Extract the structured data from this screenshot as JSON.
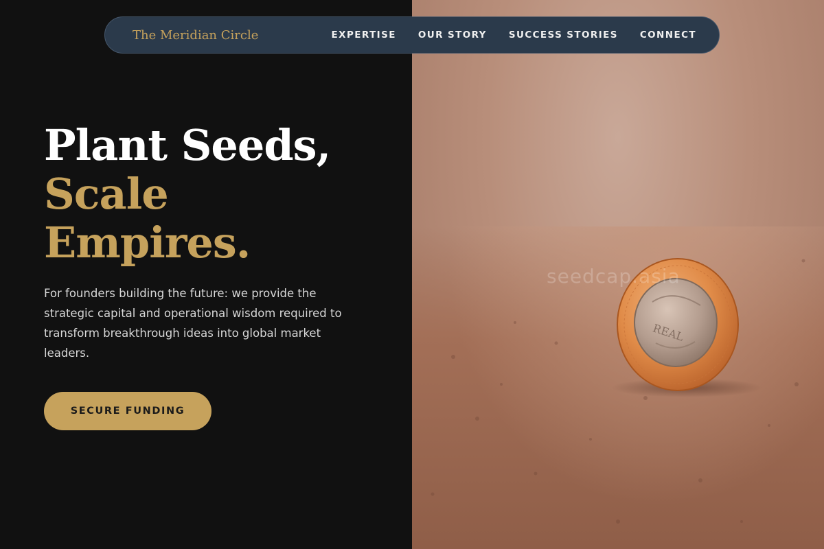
{
  "nav": {
    "brand": "The Meridian Circle",
    "links": [
      "EXPERTISE",
      "OUR STORY",
      "SUCCESS STORIES",
      "CONNECT"
    ]
  },
  "hero": {
    "headline_line1": "Plant Seeds,",
    "headline_line2": "Scale",
    "headline_line3": "Empires.",
    "description": "For founders building the future: we provide the strategic capital and operational wisdom required to transform breakthrough ideas into global market leaders.",
    "cta_label": "SECURE FUNDING"
  },
  "image": {
    "watermark": "seedcap.asia",
    "coin_text": "REAL"
  },
  "colors": {
    "background": "#111111",
    "accent_gold": "#c6a25c",
    "nav_background": "#2b3a4b",
    "headline_white": "#ffffff"
  }
}
